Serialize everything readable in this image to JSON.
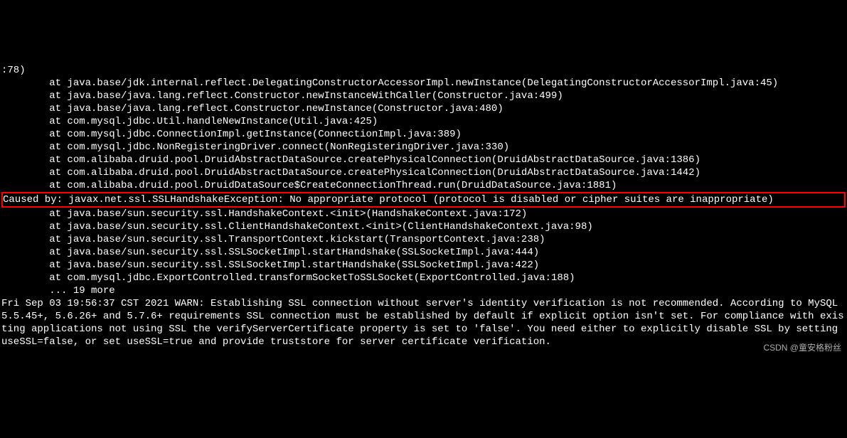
{
  "log": {
    "lines": [
      ":78)",
      "        at java.base/jdk.internal.reflect.DelegatingConstructorAccessorImpl.newInstance(DelegatingConstructorAccessorImpl.java:45)",
      "        at java.base/java.lang.reflect.Constructor.newInstanceWithCaller(Constructor.java:499)",
      "        at java.base/java.lang.reflect.Constructor.newInstance(Constructor.java:480)",
      "        at com.mysql.jdbc.Util.handleNewInstance(Util.java:425)",
      "        at com.mysql.jdbc.ConnectionImpl.getInstance(ConnectionImpl.java:389)",
      "        at com.mysql.jdbc.NonRegisteringDriver.connect(NonRegisteringDriver.java:330)",
      "        at com.alibaba.druid.pool.DruidAbstractDataSource.createPhysicalConnection(DruidAbstractDataSource.java:1386)",
      "        at com.alibaba.druid.pool.DruidAbstractDataSource.createPhysicalConnection(DruidAbstractDataSource.java:1442)",
      "        at com.alibaba.druid.pool.DruidDataSource$CreateConnectionThread.run(DruidDataSource.java:1881)"
    ],
    "caused_by": "Caused by: javax.net.ssl.SSLHandshakeException: No appropriate protocol (protocol is disabled or cipher suites are inappropriate)",
    "after": [
      "        at java.base/sun.security.ssl.HandshakeContext.<init>(HandshakeContext.java:172)",
      "        at java.base/sun.security.ssl.ClientHandshakeContext.<init>(ClientHandshakeContext.java:98)",
      "        at java.base/sun.security.ssl.TransportContext.kickstart(TransportContext.java:238)",
      "        at java.base/sun.security.ssl.SSLSocketImpl.startHandshake(SSLSocketImpl.java:444)",
      "        at java.base/sun.security.ssl.SSLSocketImpl.startHandshake(SSLSocketImpl.java:422)",
      "        at com.mysql.jdbc.ExportControlled.transformSocketToSSLSocket(ExportControlled.java:188)",
      "        ... 19 more",
      "Fri Sep 03 19:56:37 CST 2021 WARN: Establishing SSL connection without server's identity verification is not recommended. According to MySQL 5.5.45+, 5.6.26+ and 5.7.6+ requirements SSL connection must be established by default if explicit option isn't set. For compliance with existing applications not using SSL the verifyServerCertificate property is set to 'false'. You need either to explicitly disable SSL by setting useSSL=false, or set useSSL=true and provide truststore for server certificate verification."
    ]
  },
  "watermark": "CSDN @童安格粉丝"
}
